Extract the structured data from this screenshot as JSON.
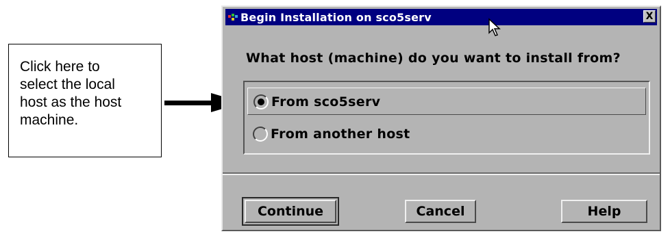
{
  "callout": {
    "lines": [
      "Click here to",
      "select the local",
      "host as the host",
      "machine."
    ]
  },
  "dialog": {
    "title": "Begin Installation on sco5serv",
    "close_label": "X",
    "question": "What host (machine) do you want to install from?",
    "options": [
      {
        "label": "From sco5serv",
        "selected": true
      },
      {
        "label": "From another host",
        "selected": false
      }
    ],
    "buttons": {
      "continue": "Continue",
      "cancel": "Cancel",
      "help": "Help"
    }
  },
  "colors": {
    "titlebar": "#000080",
    "window_bg": "#b4b4b4"
  }
}
